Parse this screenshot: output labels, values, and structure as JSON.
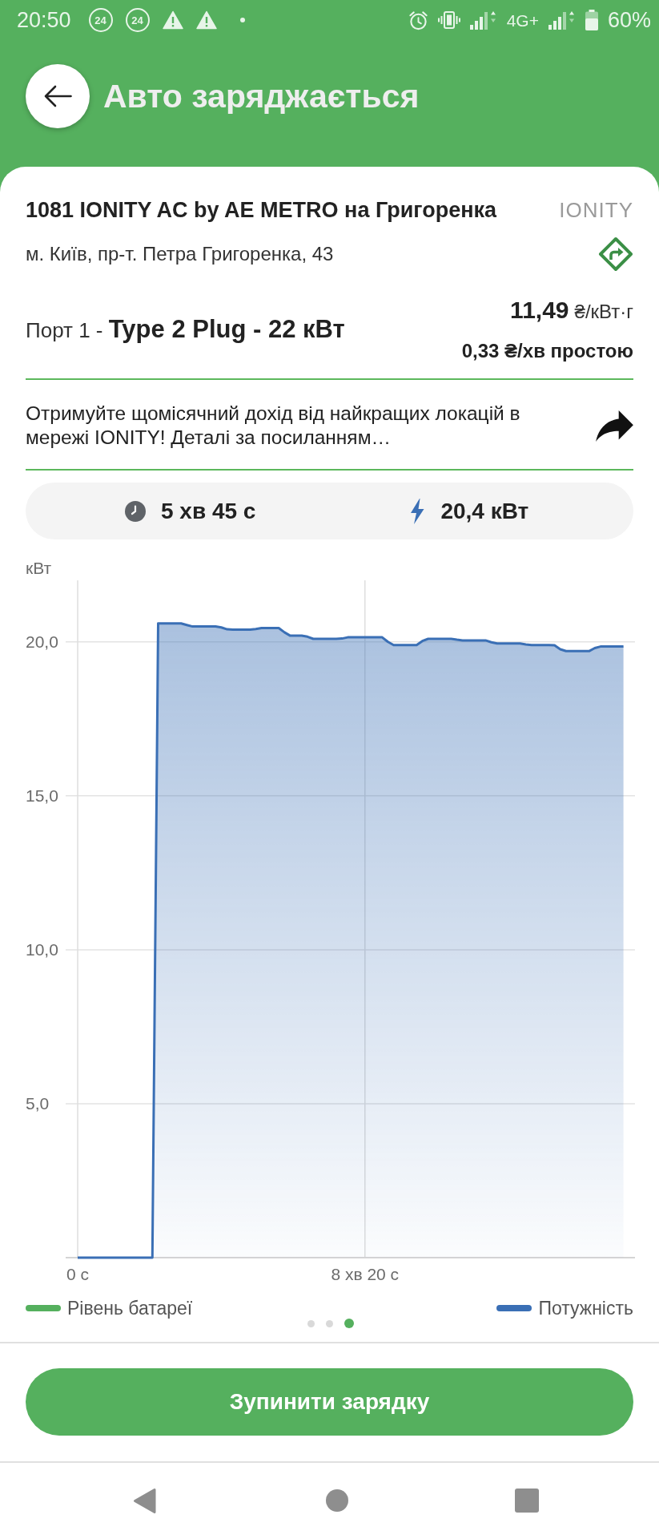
{
  "status_bar": {
    "time": "20:50",
    "notifications": [
      {
        "kind": "badge",
        "text": "24"
      },
      {
        "kind": "badge",
        "text": "24"
      },
      {
        "kind": "warning"
      },
      {
        "kind": "warning"
      },
      {
        "kind": "dot"
      }
    ],
    "indicators": [
      {
        "kind": "alarm"
      },
      {
        "kind": "vibrate"
      },
      {
        "kind": "signal"
      },
      {
        "kind": "network",
        "text": "4G+"
      },
      {
        "kind": "signal"
      },
      {
        "kind": "battery"
      },
      {
        "kind": "battery_percent",
        "text": "60%"
      }
    ]
  },
  "header": {
    "title": "Авто заряджається"
  },
  "station": {
    "name": "1081 IONITY AC by AE METRO на Григоренка",
    "operator_logo": "IONITY",
    "address": "м. Київ, пр-т. Петра Григоренка, 43",
    "port": "Порт 1 - **Type 2 Plug - 22 кВт**",
    "price": "11,49",
    "price_unit": "₴/кВт·г",
    "idle_fee": "0,33 ₴/хв простою"
  },
  "promo": {
    "text": "Отримуйте щомісячний дохід від найкращих локацій в мережі IONITY! Деталі за посиланням…"
  },
  "stats": [
    {
      "kind": "duration",
      "value": "5 хв 45 с"
    },
    {
      "kind": "power",
      "value": "20,4 кВт"
    }
  ],
  "chart": {
    "chart_data": {
      "type": "area",
      "grid": true,
      "ylabel": "кВт",
      "categories": [
        "0 с",
        null,
        null,
        null,
        null,
        null,
        null,
        null,
        null,
        null,
        null,
        null,
        null,
        null,
        null,
        null,
        null,
        null,
        null,
        null,
        null,
        null,
        null,
        null,
        null,
        null,
        null,
        null,
        null,
        null,
        null,
        null,
        null,
        null,
        null,
        null,
        null,
        null,
        null,
        null,
        null,
        null,
        null,
        null,
        null,
        null,
        null,
        null,
        null,
        null,
        "8 хв 20 с",
        null,
        null,
        null,
        null,
        null,
        null,
        null,
        null,
        null,
        null,
        null,
        null,
        null,
        null,
        null,
        null,
        null,
        null,
        null,
        null,
        null,
        null,
        null,
        null,
        null,
        null,
        null,
        null,
        null,
        null,
        null,
        null,
        null,
        null,
        null,
        null,
        null,
        null,
        null,
        null,
        null,
        null,
        null,
        null,
        null,
        null,
        null
      ],
      "series": [
        {
          "name": "Рівень батареї",
          "color": "#55b05e",
          "values": [
            null,
            null,
            null,
            null,
            null,
            null,
            null,
            null,
            null,
            null,
            null,
            null,
            null,
            null,
            null,
            null,
            null,
            null,
            null,
            null,
            null,
            null,
            null,
            null,
            null,
            null,
            null,
            null,
            null,
            null,
            null,
            null,
            null,
            null,
            null,
            null,
            null,
            null,
            null,
            null,
            null,
            null,
            null,
            null,
            null,
            null,
            null,
            null,
            null,
            null,
            null,
            null,
            null,
            null,
            null,
            null,
            null,
            null,
            null,
            null,
            null,
            null,
            null,
            null,
            null,
            null,
            null,
            null,
            null,
            null,
            null,
            null,
            null,
            null,
            null,
            null,
            null,
            null,
            null,
            null,
            null,
            null,
            null,
            null,
            null,
            null,
            null,
            null,
            null,
            null,
            null,
            null,
            null,
            null,
            null,
            null,
            null,
            null
          ]
        },
        {
          "name": "Потужність",
          "color": "#3a6fb5",
          "values": [
            0,
            0,
            0,
            0,
            0,
            0,
            0,
            0,
            0,
            0,
            0,
            0,
            0,
            0,
            20.6,
            20.6,
            20.6,
            20.6,
            20.6,
            20.55,
            20.5,
            20.5,
            20.5,
            20.5,
            20.5,
            20.47,
            20.41,
            20.4,
            20.4,
            20.4,
            20.4,
            20.42,
            20.45,
            20.45,
            20.45,
            20.45,
            20.31,
            20.2,
            20.2,
            20.2,
            20.17,
            20.1,
            20.1,
            20.1,
            20.1,
            20.1,
            20.11,
            20.15,
            20.15,
            20.15,
            20.15,
            20.15,
            20.15,
            20.15,
            20.0,
            19.9,
            19.9,
            19.9,
            19.9,
            19.9,
            20.03,
            20.1,
            20.1,
            20.1,
            20.1,
            20.1,
            20.07,
            20.05,
            20.05,
            20.05,
            20.05,
            20.05,
            19.99,
            19.95,
            19.95,
            19.95,
            19.95,
            19.95,
            19.92,
            19.9,
            19.9,
            19.9,
            19.9,
            19.89,
            19.76,
            19.7,
            19.7,
            19.7,
            19.7,
            19.7,
            19.8,
            19.85,
            19.85,
            19.85,
            19.85,
            19.85,
            null,
            null
          ]
        }
      ],
      "ylim": [
        0,
        22
      ],
      "yticks": [
        {
          "value": 5,
          "label": "5,0"
        },
        {
          "value": 10,
          "label": "10,0"
        },
        {
          "value": 15,
          "label": "15,0"
        },
        {
          "value": 20,
          "label": "20,0"
        }
      ]
    }
  },
  "pager": [
    {
      "selected": false
    },
    {
      "selected": false
    },
    {
      "selected": true
    }
  ],
  "stop_button": {
    "label": "Зупинити зарядку"
  },
  "nav_bar": [
    {
      "kind": "back"
    },
    {
      "kind": "home"
    },
    {
      "kind": "recents"
    }
  ]
}
